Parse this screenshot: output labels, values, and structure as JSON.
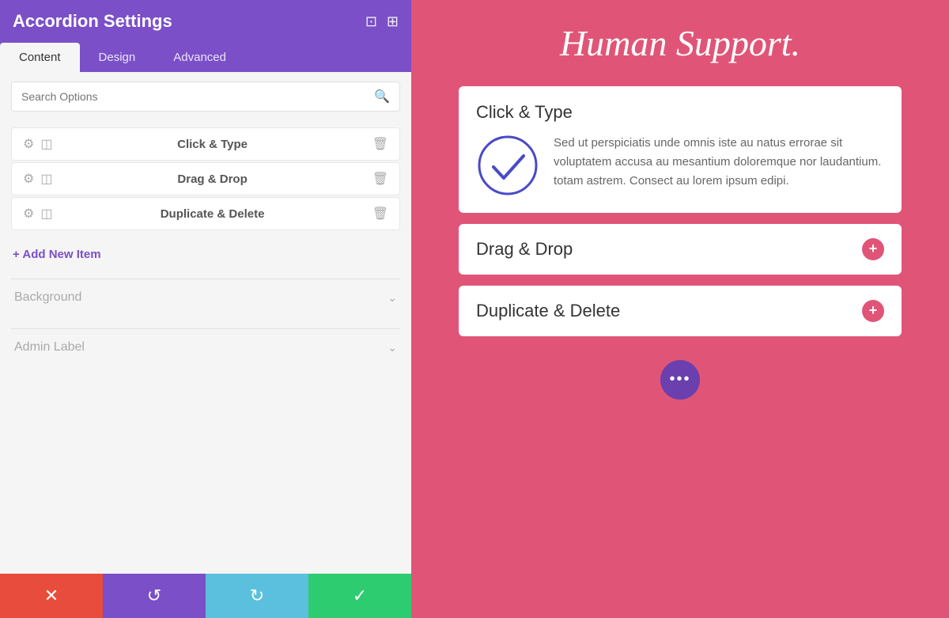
{
  "panel": {
    "title": "Accordion Settings",
    "header_icons": [
      "expand",
      "layout"
    ],
    "tabs": [
      {
        "id": "content",
        "label": "Content",
        "active": true
      },
      {
        "id": "design",
        "label": "Design",
        "active": false
      },
      {
        "id": "advanced",
        "label": "Advanced",
        "active": false
      }
    ],
    "search_placeholder": "Search Options",
    "accordion_items": [
      {
        "label": "Click & Type"
      },
      {
        "label": "Drag & Drop"
      },
      {
        "label": "Duplicate & Delete"
      }
    ],
    "add_new_label": "+ Add New Item",
    "sections": [
      {
        "label": "Background"
      },
      {
        "label": "Admin Label"
      }
    ],
    "toolbar": {
      "cancel_icon": "✕",
      "undo_icon": "↺",
      "redo_icon": "↻",
      "save_icon": "✓"
    }
  },
  "preview": {
    "hero_title": "Human Support.",
    "accordion_cards": [
      {
        "id": "click-type",
        "title": "Click & Type",
        "open": true,
        "body_text": "Sed ut perspiciatis unde omnis iste au natus errorae sit voluptatem accusa au mesantium doloremque nor laudantium. totam astrem. Consect au lorem ipsum edipi."
      },
      {
        "id": "drag-drop",
        "title": "Drag & Drop",
        "open": false
      },
      {
        "id": "duplicate-delete",
        "title": "Duplicate & Delete",
        "open": false
      }
    ],
    "floating_dots": "•••"
  }
}
